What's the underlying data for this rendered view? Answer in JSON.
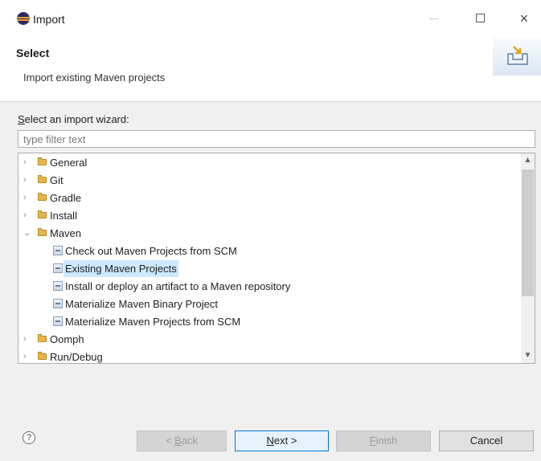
{
  "window": {
    "title": "Import",
    "icon": "eclipse-icon",
    "controls": {
      "minimize": "minimize-icon",
      "maximize": "maximize-icon",
      "close": "×"
    }
  },
  "header": {
    "title": "Select",
    "description": "Import existing Maven projects",
    "banner_icon": "import-wizard-icon"
  },
  "wizard": {
    "label_mnemonic": "S",
    "label_rest": "elect an import wizard:",
    "filter_placeholder": "type filter text",
    "filter_value": ""
  },
  "tree": {
    "items": [
      {
        "label": "General",
        "type": "folder",
        "expanded": false
      },
      {
        "label": "Git",
        "type": "folder",
        "expanded": false
      },
      {
        "label": "Gradle",
        "type": "folder",
        "expanded": false
      },
      {
        "label": "Install",
        "type": "folder",
        "expanded": false
      },
      {
        "label": "Maven",
        "type": "folder",
        "expanded": true
      },
      {
        "label": "Check out Maven Projects from SCM",
        "type": "item"
      },
      {
        "label": "Existing Maven Projects",
        "type": "item",
        "selected": true
      },
      {
        "label": "Install or deploy an artifact to a Maven repository",
        "type": "item"
      },
      {
        "label": "Materialize Maven Binary Project",
        "type": "item"
      },
      {
        "label": "Materialize Maven Projects from SCM",
        "type": "item"
      },
      {
        "label": "Oomph",
        "type": "folder",
        "expanded": false
      },
      {
        "label": "Run/Debug",
        "type": "folder",
        "expanded": false
      }
    ],
    "twisty_collapsed": "›",
    "twisty_expanded": "⌄"
  },
  "footer": {
    "help": "?",
    "back": {
      "pre": "< ",
      "mn": "B",
      "post": "ack"
    },
    "next": {
      "mn": "N",
      "post": "ext >"
    },
    "finish": {
      "mn": "F",
      "post": "inish"
    },
    "cancel": "Cancel"
  },
  "colors": {
    "selection": "#cde8ff",
    "default_button_border": "#0078d7",
    "dialog_background": "#f0f0f0"
  }
}
